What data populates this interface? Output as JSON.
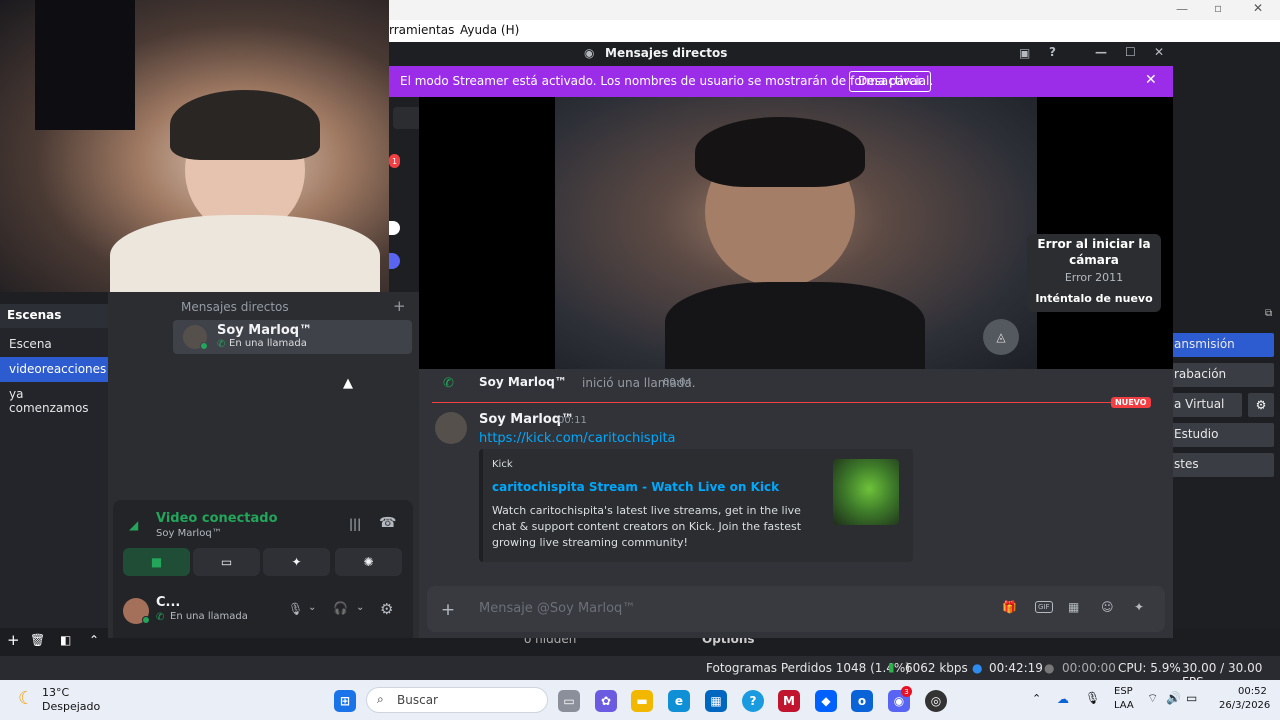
{
  "obs": {
    "menu": {
      "tools": "rramientas",
      "help": "Ayuda (H)"
    },
    "scenes_title": "Escenas",
    "scenes": [
      "Escena",
      "videoreacciones",
      "ya comenzamos"
    ],
    "right_buttons": [
      "ansmisión",
      "rabación",
      "a Virtual",
      "Estudio",
      "stes"
    ],
    "bottom": {
      "hidden_label": "o hidden",
      "options_label": "Options"
    },
    "status": {
      "dropped": "Fotogramas Perdidos 1048 (1.4%)",
      "bitrate": "6062 kbps",
      "live_time": "00:42:19",
      "rec_time": "00:00:00",
      "cpu": "CPU: 5.9%",
      "fps": "30.00 / 30.00 FPS"
    }
  },
  "discord": {
    "window_title": "Mensajes directos",
    "banner": {
      "text": "El modo Streamer está activado. Los nombres de usuario se mostrarán de forma parcial.",
      "button": "Desactivar"
    },
    "server_badge": "1",
    "dm_header": "Mensajes directos",
    "dm_add": "+",
    "dm_user": {
      "name": "Soy Marloq™",
      "status": "En una llamada"
    },
    "camera_error": {
      "title": "Error al iniciar la cámara",
      "code": "Error 2011",
      "retry": "Inténtalo de nuevo"
    },
    "call_event": {
      "user": "Soy Marloq™",
      "text": "inició una llamada.",
      "time": "00:04"
    },
    "new_label": "NUEVO",
    "message": {
      "author": "Soy Marloq™",
      "time": "00:11",
      "link": "https://kick.com/caritochispita",
      "embed": {
        "provider": "Kick",
        "title": "caritochispita Stream - Watch Live on Kick",
        "description": "Watch caritochispita's latest live streams, get in the live chat & support content creators on Kick. Join the fastest growing live streaming community!"
      }
    },
    "composer_placeholder": "Mensaje @Soy Marloq™",
    "voice": {
      "status": "Video conectado",
      "with": "Soy Marloq™"
    },
    "self": {
      "name": "C...",
      "status": "En una llamada"
    },
    "colors": {
      "banner": "#9b2de8",
      "link": "#00a8fc",
      "green": "#23a55a",
      "new": "#f23f43"
    }
  },
  "taskbar": {
    "weather_temp": "13°C",
    "weather_text": "Despejado",
    "search_placeholder": "Buscar",
    "lang_top": "ESP",
    "lang_bottom": "LAA",
    "time": "00:52",
    "date": "26/3/2026",
    "discord_badge": "3"
  }
}
